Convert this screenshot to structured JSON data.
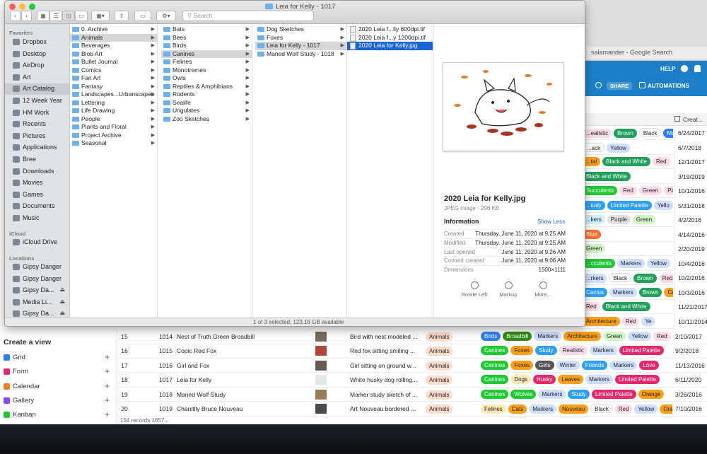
{
  "finder": {
    "title": "Leia for Kelly - 1017",
    "search_placeholder": "Search",
    "status": "1 of 3 selected, 123.16 GB available",
    "sidebar": {
      "favorites_header": "Favorites",
      "favorites": [
        "Dropbox",
        "Desktop",
        "AirDrop",
        "Art",
        "Art Catalog",
        "12 Week Year",
        "HM Work",
        "Recents",
        "Pictures",
        "Applications",
        "Bree",
        "Downloads",
        "Movies",
        "Games",
        "Documents",
        "Music"
      ],
      "icloud_header": "iCloud",
      "icloud": [
        "iCloud Drive"
      ],
      "locations_header": "Locations",
      "locations": [
        "Gipsy Danger",
        "Gipsy Danger",
        "Gipsy Da...",
        "Media Li...",
        "Gipsy Da..."
      ]
    },
    "col1": [
      "0. Archive",
      "Animals",
      "Beverages",
      "Blob Art",
      "Bullet Journal",
      "Comics",
      "Fan Art",
      "Fantasy",
      "Landscapes...Urbanscapes",
      "Lettering",
      "Life Drawing",
      "People",
      "Plants and Floral",
      "Project Archive",
      "Seasonal"
    ],
    "col2": [
      "Bats",
      "Bees",
      "Birds",
      "Canines",
      "Felines",
      "Monotremes",
      "Owls",
      "Reptiles & Amphibians",
      "Rodents",
      "Sealife",
      "Ungulates",
      "Zoo Sketches"
    ],
    "col3": [
      "Dog Sketches",
      "Foxes",
      "Leia for Kelly - 1017",
      "Maned Wolf Study - 1018"
    ],
    "col4": [
      "2020 Leia f...lly 600dpi.tif",
      "2020 Leia f...y 1200dpi.tif",
      "2020 Leia for Kelly.jpg"
    ],
    "preview": {
      "name": "2020 Leia for Kelly.jpg",
      "kind": "JPEG image - 296 KB",
      "info_header": "Information",
      "show_less": "Show Less",
      "rows": [
        {
          "k": "Created",
          "v": "Thursday, June 11, 2020 at 9:25 AM"
        },
        {
          "k": "Modified",
          "v": "Thursday, June 11, 2020 at 9:25 AM"
        },
        {
          "k": "Last opened",
          "v": "June 11, 2020 at 9:26 AM"
        },
        {
          "k": "Content created",
          "v": "June 11, 2020 at 9:06 AM"
        },
        {
          "k": "Dimensions",
          "v": "1500×1111"
        }
      ],
      "actions": [
        "Rotate Left",
        "Markup",
        "More..."
      ]
    }
  },
  "browser": {
    "tab_title": "salamander - Google Search"
  },
  "airtable": {
    "help": "HELP",
    "share": "SHARE",
    "automations": "AUTOMATIONS",
    "created_header": "Creat...",
    "create_view": "Create a view",
    "views": [
      {
        "label": "Grid",
        "color": "#2d7ff9"
      },
      {
        "label": "Form",
        "color": "#e3296b"
      },
      {
        "label": "Calendar",
        "color": "#f27c21"
      },
      {
        "label": "Gallery",
        "color": "#8b46ff"
      },
      {
        "label": "Kanban",
        "color": "#20c933"
      }
    ],
    "bg_rows": [
      {
        "tags": [
          [
            "...ealistic",
            "#ffdce5"
          ],
          [
            "Brown",
            "#20a05a"
          ],
          [
            "Black",
            "#ffffff"
          ],
          [
            "Ma",
            "#2d7ff9"
          ]
        ],
        "date": "6/24/2017"
      },
      {
        "tags": [
          [
            "...ack",
            "#ffffff"
          ],
          [
            "Yellow",
            "#cfdfff"
          ]
        ],
        "date": "6/7/2018"
      },
      {
        "tags": [
          [
            "...tal",
            "#ff9f1a"
          ],
          [
            "Black and White",
            "#20a05a"
          ],
          [
            "Red",
            "#ffdce5"
          ]
        ],
        "date": "12/1/2017"
      },
      {
        "tags": [
          [
            "Black and White",
            "#20a05a"
          ]
        ],
        "date": "3/19/2019"
      },
      {
        "tags": [
          [
            "Succulents",
            "#20c933"
          ],
          [
            "Red",
            "#ffdce5"
          ],
          [
            "Green",
            "#ffdce5"
          ],
          [
            "Pink",
            "#ffdce5"
          ]
        ],
        "date": "10/1/2016"
      },
      {
        "tags": [
          [
            "...tudy",
            "#2d9ff5"
          ],
          [
            "Limited Palette",
            "#2d9ff5"
          ],
          [
            "Yello",
            "#cfdfff"
          ]
        ],
        "date": "5/31/2018"
      },
      {
        "tags": [
          [
            "...kers",
            "#d0f0fd"
          ],
          [
            "Purple",
            "#e0e0e0"
          ],
          [
            "Green",
            "#d1f7c4"
          ]
        ],
        "date": "4/2/2016"
      },
      {
        "tags": [
          [
            "Blue",
            "#ff6f2c"
          ]
        ],
        "date": "4/14/2016"
      },
      {
        "tags": [
          [
            "Green",
            "#d1f7c4"
          ]
        ],
        "date": "2/20/2019"
      },
      {
        "tags": [
          [
            "...cculents",
            "#20c933"
          ],
          [
            "Markers",
            "#cfdfff"
          ],
          [
            "Yellow",
            "#cfdfff"
          ]
        ],
        "date": "10/4/2016"
      },
      {
        "tags": [
          [
            "...rkers",
            "#cfdfff"
          ],
          [
            "Black",
            "#ffffff"
          ],
          [
            "Brown",
            "#20a05a"
          ],
          [
            "Red",
            "#ffdce5"
          ]
        ],
        "date": "10/2/2016"
      },
      {
        "tags": [
          [
            "Cactus",
            "#2d9ff5"
          ],
          [
            "Markers",
            "#cfdfff"
          ],
          [
            "Brown",
            "#20a05a"
          ],
          [
            "Co",
            "#ff9f1a"
          ]
        ],
        "date": "10/3/2016"
      },
      {
        "tags": [
          [
            "Red",
            "#ffdce5"
          ],
          [
            "Black and White",
            "#20a05a"
          ]
        ],
        "date": "11/21/2017"
      },
      {
        "tags": [
          [
            "Architecture",
            "#ff9f1a"
          ],
          [
            "Red",
            "#ffdce5"
          ],
          [
            "Ye",
            "#cfdfff"
          ]
        ],
        "date": "10/11/2014"
      }
    ],
    "rows": [
      {
        "num": "15",
        "id": "1014",
        "name": "Nest of Truth Green Broadbill",
        "desc": "Bird with nest modeled ...",
        "cat": "Animals",
        "tags": [
          [
            "Birds",
            "#2d7ff9"
          ],
          [
            "Broadbill",
            "#338a17"
          ],
          [
            "Markers",
            "#cfdfff"
          ],
          [
            "Architecture",
            "#ff9f1a"
          ],
          [
            "Green",
            "#d1f7c4"
          ],
          [
            "Yellow",
            "#cfdfff"
          ],
          [
            "Red",
            "#ffdce5"
          ]
        ],
        "date": "2/10/2017"
      },
      {
        "num": "16",
        "id": "1015",
        "name": "Copic Red Fox",
        "desc": "Red fox sitting smiling ...",
        "cat": "Animals",
        "tags": [
          [
            "Canines",
            "#20c933"
          ],
          [
            "Foxes",
            "#ff9f1a"
          ],
          [
            "Study",
            "#2d9ff5"
          ],
          [
            "Realistic",
            "#ffdce5"
          ],
          [
            "Markers",
            "#cfdfff"
          ],
          [
            "Limited Palette",
            "#e3296b"
          ]
        ],
        "date": "9/2/2018"
      },
      {
        "num": "17",
        "id": "1016",
        "name": "Girl and Fox",
        "desc": "Girl sitting on ground w...",
        "cat": "Animals",
        "tags": [
          [
            "Canines",
            "#20c933"
          ],
          [
            "Foxes",
            "#ff9f1a"
          ],
          [
            "Girls",
            "#555555"
          ],
          [
            "Winter",
            "#cfdfff"
          ],
          [
            "Friends",
            "#2d9ff5"
          ],
          [
            "Markers",
            "#cfdfff"
          ],
          [
            "Love",
            "#e3296b"
          ]
        ],
        "date": "11/13/2016"
      },
      {
        "num": "18",
        "id": "1017",
        "name": "Leia for Kelly",
        "desc": "White husky dog rolling...",
        "cat": "Animals",
        "tags": [
          [
            "Canines",
            "#20c933"
          ],
          [
            "Dogs",
            "#ffeab6"
          ],
          [
            "Husky",
            "#e3296b"
          ],
          [
            "Leaves",
            "#ff9f1a"
          ],
          [
            "Markers",
            "#cfdfff"
          ],
          [
            "Limited Palette",
            "#e3296b"
          ]
        ],
        "date": "6/11/2020"
      },
      {
        "num": "19",
        "id": "1018",
        "name": "Maned Wolf Study",
        "desc": "Marker study sketch of ...",
        "cat": "Animals",
        "tags": [
          [
            "Canines",
            "#20c933"
          ],
          [
            "Wolves",
            "#20c933"
          ],
          [
            "Markers",
            "#cfdfff"
          ],
          [
            "Study",
            "#2d9ff5"
          ],
          [
            "Limited Palette",
            "#e3296b"
          ],
          [
            "Orange",
            "#ff9f1a"
          ]
        ],
        "date": "3/26/2016"
      },
      {
        "num": "20",
        "id": "1019",
        "name": "Chanitlly Bruce Nouveau",
        "desc": "Art Nouveau bordered ...",
        "cat": "Animals",
        "tags": [
          [
            "Felines",
            "#ffeab6"
          ],
          [
            "Cats",
            "#ff9f1a"
          ],
          [
            "Markers",
            "#cfdfff"
          ],
          [
            "Nouveau",
            "#ff9f1a"
          ],
          [
            "Black",
            "#ffffff"
          ],
          [
            "Red",
            "#ffdce5"
          ],
          [
            "Yellow",
            "#cfdfff"
          ],
          [
            "Ora",
            "#ff9f1a"
          ]
        ],
        "date": "7/10/2016"
      }
    ],
    "footer": "154 records 1657..."
  }
}
